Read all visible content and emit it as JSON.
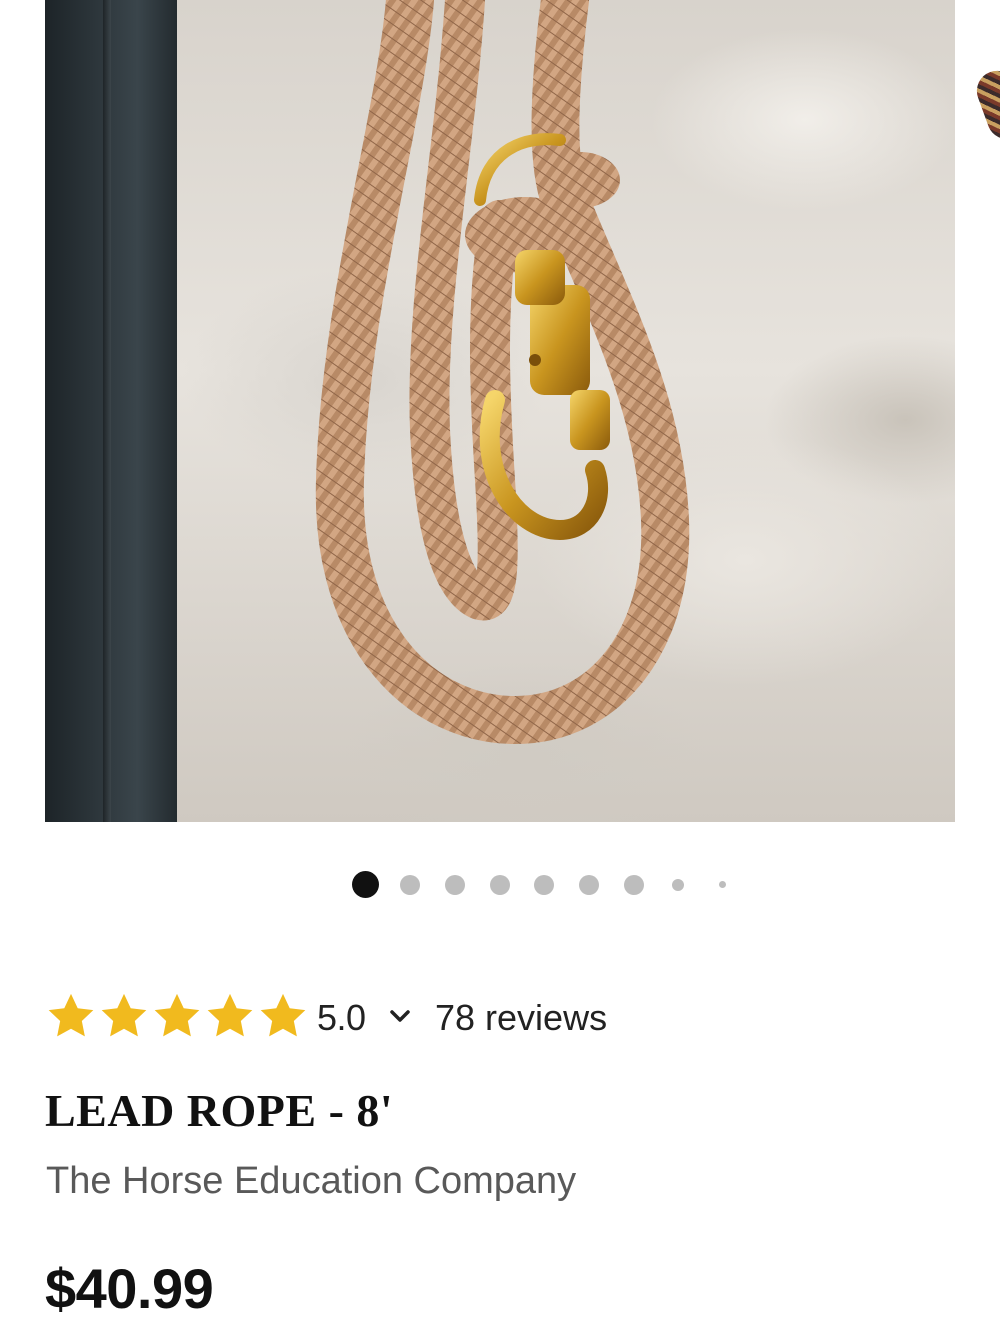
{
  "gallery": {
    "image_alt": "LEAD ROPE - 8'",
    "page_count": 9,
    "active_index": 0
  },
  "rating": {
    "stars": 5,
    "value": "5.0",
    "reviews_label": "78 reviews"
  },
  "product": {
    "title": "LEAD ROPE - 8'",
    "shop_name": "The Horse Education Company",
    "price": "$40.99"
  },
  "colors": {
    "star": "#F1BA1E",
    "text_primary": "#111111",
    "text_secondary": "#595959",
    "dot_active": "#111111",
    "dot_inactive": "#BDBDBD"
  }
}
